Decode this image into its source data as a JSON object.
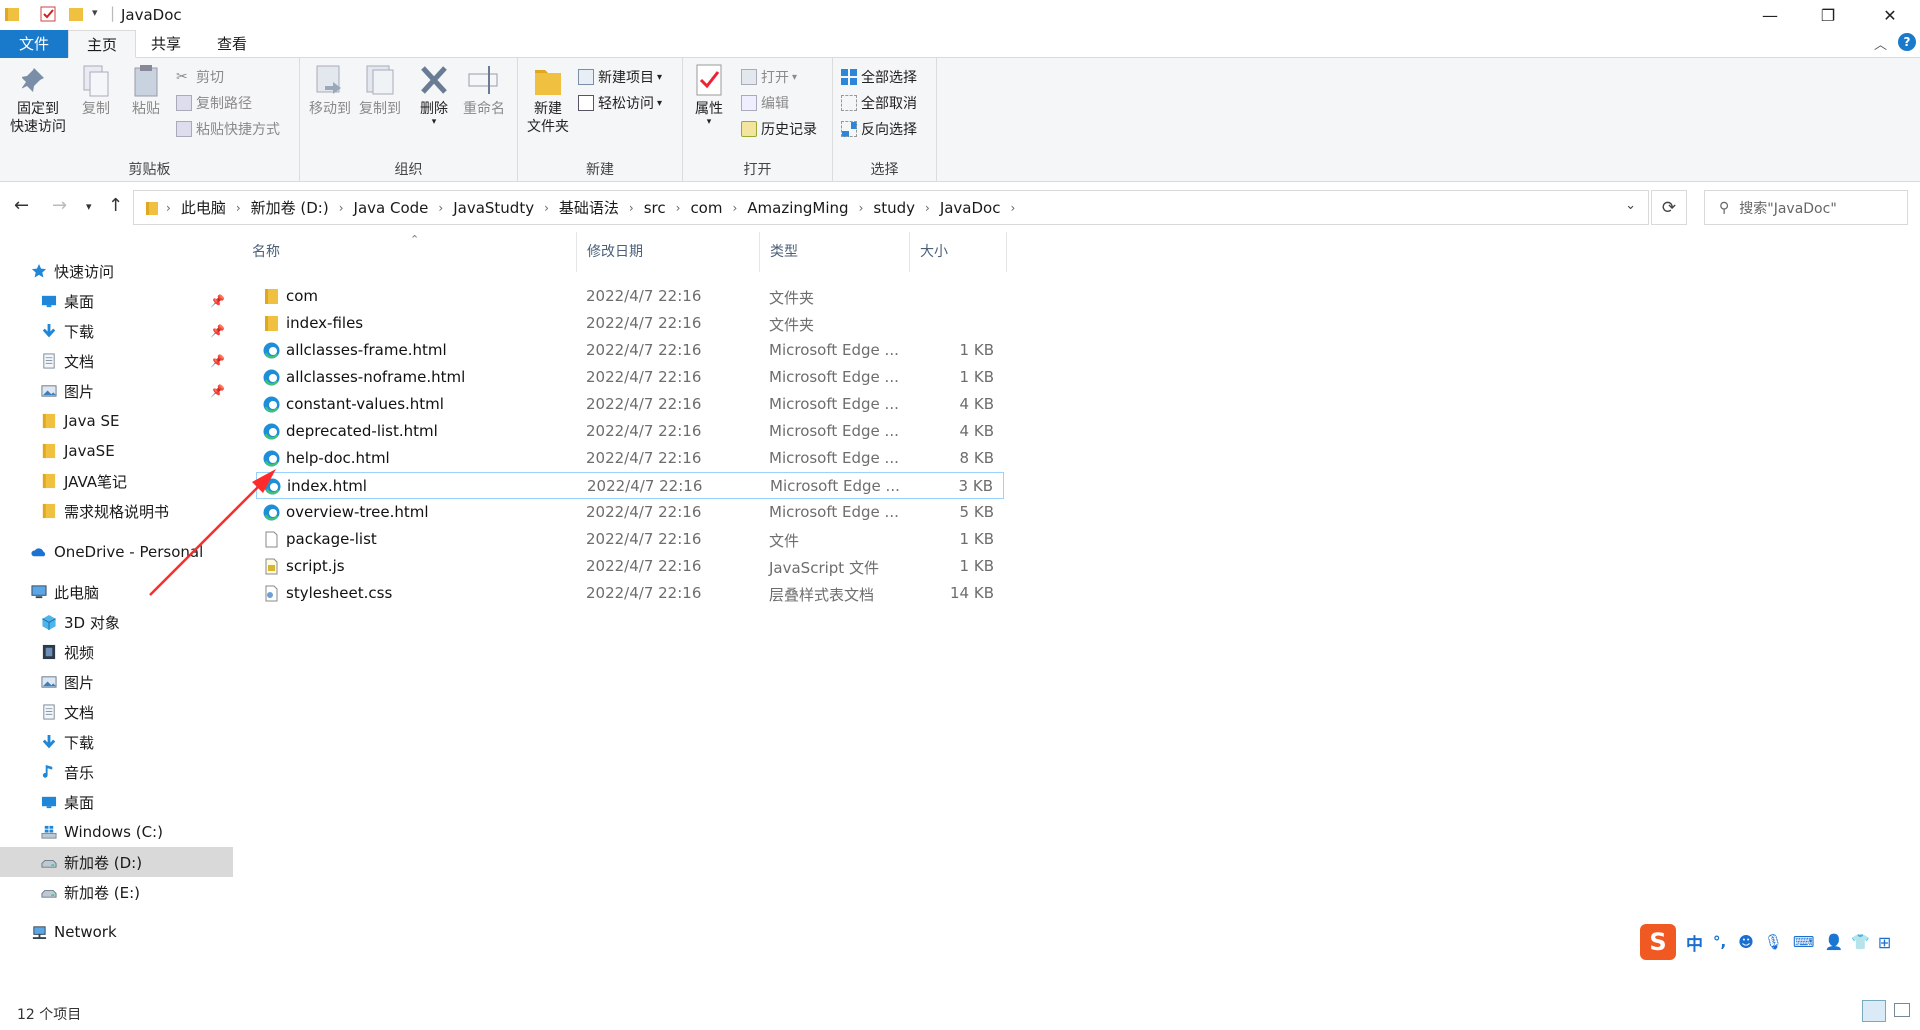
{
  "window": {
    "title": "JavaDoc",
    "min": "—",
    "max": "❐",
    "close": "✕"
  },
  "ribbon_tabs": {
    "file": "文件",
    "home": "主页",
    "share": "共享",
    "view": "查看"
  },
  "ribbon": {
    "clipboard": {
      "label": "剪贴板",
      "pin": "固定到\n快速访问",
      "pin_l1": "固定到",
      "pin_l2": "快速访问",
      "copy": "复制",
      "paste": "粘贴",
      "cut": "剪切",
      "copy_path": "复制路径",
      "paste_shortcut": "粘贴快捷方式"
    },
    "organize": {
      "label": "组织",
      "move_to": "移动到",
      "copy_to": "复制到",
      "delete": "删除",
      "rename": "重命名"
    },
    "new": {
      "label": "新建",
      "new_folder_l1": "新建",
      "new_folder_l2": "文件夹",
      "new_item": "新建项目",
      "easy_access": "轻松访问"
    },
    "open": {
      "label": "打开",
      "properties": "属性",
      "open": "打开",
      "edit": "编辑",
      "history": "历史记录"
    },
    "select": {
      "label": "选择",
      "select_all": "全部选择",
      "select_none": "全部取消",
      "invert": "反向选择"
    }
  },
  "breadcrumbs": [
    "此电脑",
    "新加卷 (D:)",
    "Java Code",
    "JavaStudty",
    "基础语法",
    "src",
    "com",
    "AmazingMing",
    "study",
    "JavaDoc"
  ],
  "search": {
    "placeholder": "搜索\"JavaDoc\""
  },
  "sidebar": {
    "quick_access": "快速访问",
    "quick_items": [
      {
        "label": "桌面",
        "icon": "desktop-icon",
        "pinned": true
      },
      {
        "label": "下载",
        "icon": "download-icon",
        "pinned": true
      },
      {
        "label": "文档",
        "icon": "document-icon",
        "pinned": true
      },
      {
        "label": "图片",
        "icon": "pictures-icon",
        "pinned": true
      },
      {
        "label": "Java SE",
        "icon": "folder-icon",
        "pinned": false
      },
      {
        "label": "JavaSE",
        "icon": "folder-icon",
        "pinned": false
      },
      {
        "label": "JAVA笔记",
        "icon": "folder-icon",
        "pinned": false
      },
      {
        "label": "需求规格说明书",
        "icon": "folder-icon",
        "pinned": false
      }
    ],
    "onedrive": "OneDrive - Personal",
    "this_pc": "此电脑",
    "pc_items": [
      {
        "label": "3D 对象",
        "icon": "3d-objects-icon"
      },
      {
        "label": "视频",
        "icon": "video-icon"
      },
      {
        "label": "图片",
        "icon": "pictures-icon"
      },
      {
        "label": "文档",
        "icon": "document-icon"
      },
      {
        "label": "下载",
        "icon": "download-icon"
      },
      {
        "label": "音乐",
        "icon": "music-icon"
      },
      {
        "label": "桌面",
        "icon": "desktop-icon"
      },
      {
        "label": "Windows (C:)",
        "icon": "windows-drive-icon"
      },
      {
        "label": "新加卷 (D:)",
        "icon": "drive-icon",
        "selected": true
      },
      {
        "label": "新加卷 (E:)",
        "icon": "drive-icon"
      }
    ],
    "network": "Network"
  },
  "columns": {
    "name": "名称",
    "date": "修改日期",
    "type": "类型",
    "size": "大小"
  },
  "files": [
    {
      "name": "com",
      "date": "2022/4/7 22:16",
      "type": "文件夹",
      "size": "",
      "icon": "folder-icon"
    },
    {
      "name": "index-files",
      "date": "2022/4/7 22:16",
      "type": "文件夹",
      "size": "",
      "icon": "folder-icon"
    },
    {
      "name": "allclasses-frame.html",
      "date": "2022/4/7 22:16",
      "type": "Microsoft Edge ...",
      "size": "1 KB",
      "icon": "edge-icon"
    },
    {
      "name": "allclasses-noframe.html",
      "date": "2022/4/7 22:16",
      "type": "Microsoft Edge ...",
      "size": "1 KB",
      "icon": "edge-icon"
    },
    {
      "name": "constant-values.html",
      "date": "2022/4/7 22:16",
      "type": "Microsoft Edge ...",
      "size": "4 KB",
      "icon": "edge-icon"
    },
    {
      "name": "deprecated-list.html",
      "date": "2022/4/7 22:16",
      "type": "Microsoft Edge ...",
      "size": "4 KB",
      "icon": "edge-icon"
    },
    {
      "name": "help-doc.html",
      "date": "2022/4/7 22:16",
      "type": "Microsoft Edge ...",
      "size": "8 KB",
      "icon": "edge-icon"
    },
    {
      "name": "index.html",
      "date": "2022/4/7 22:16",
      "type": "Microsoft Edge ...",
      "size": "3 KB",
      "icon": "edge-icon",
      "focused": true
    },
    {
      "name": "overview-tree.html",
      "date": "2022/4/7 22:16",
      "type": "Microsoft Edge ...",
      "size": "5 KB",
      "icon": "edge-icon"
    },
    {
      "name": "package-list",
      "date": "2022/4/7 22:16",
      "type": "文件",
      "size": "1 KB",
      "icon": "file-icon"
    },
    {
      "name": "script.js",
      "date": "2022/4/7 22:16",
      "type": "JavaScript 文件",
      "size": "1 KB",
      "icon": "script-icon"
    },
    {
      "name": "stylesheet.css",
      "date": "2022/4/7 22:16",
      "type": "层叠样式表文档",
      "size": "14 KB",
      "icon": "css-icon"
    }
  ],
  "status": {
    "count": "12 个项目"
  },
  "ime": {
    "lang": "中"
  },
  "colors": {
    "accent": "#1979ca",
    "annotation_arrow": "#ff2a2a",
    "folder": "#f0c040",
    "edge": "#1d8fd8"
  }
}
